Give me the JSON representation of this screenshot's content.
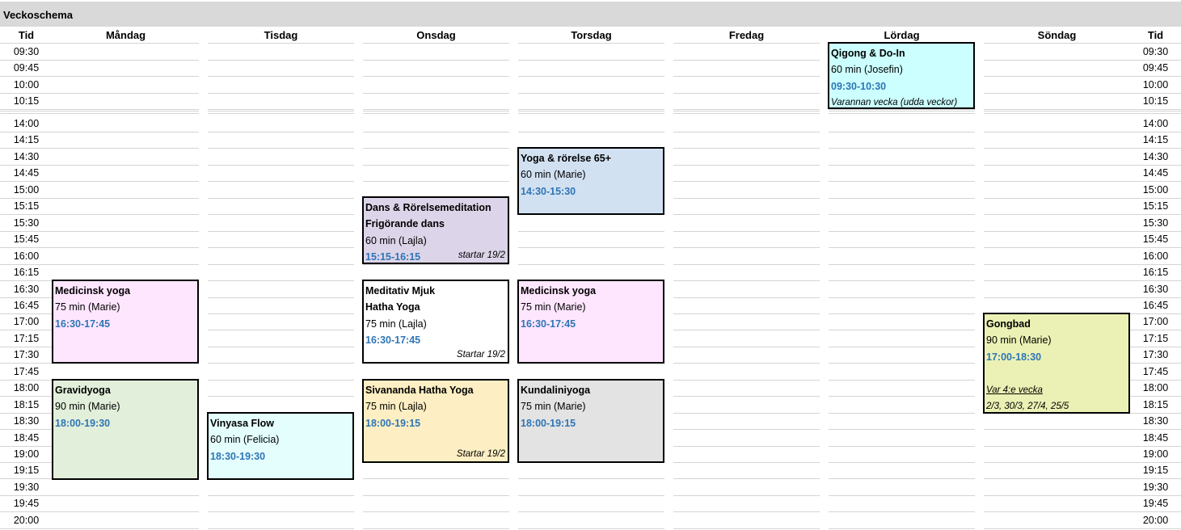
{
  "sheet": {
    "title": "Veckoschema"
  },
  "headers": {
    "tid": "Tid",
    "days": [
      "Måndag",
      "Tisdag",
      "Onsdag",
      "Torsdag",
      "Fredag",
      "Lördag",
      "Söndag"
    ]
  },
  "times": [
    "09:30",
    "09:45",
    "10:00",
    "10:15",
    "14:00",
    "14:15",
    "14:30",
    "14:45",
    "15:00",
    "15:15",
    "15:30",
    "15:45",
    "16:00",
    "16:15",
    "16:30",
    "16:45",
    "17:00",
    "17:15",
    "17:30",
    "17:45",
    "18:00",
    "18:15",
    "18:30",
    "18:45",
    "19:00",
    "19:15",
    "19:30",
    "19:45",
    "20:00"
  ],
  "classes": {
    "mon_medicinsk": {
      "title": "Medicinsk yoga",
      "info": "75 min (Marie)",
      "time": "16:30-17:45",
      "color": "#ffe6ff"
    },
    "mon_gravid": {
      "title": "Gravidyoga",
      "info": "90 min (Marie)",
      "time": "18:00-19:30",
      "color": "#e2efda"
    },
    "tue_vinyasa": {
      "title": "Vinyasa Flow",
      "info": "60 min (Felicia)",
      "time": "18:30-19:30",
      "color": "#e4fefe"
    },
    "wed_dans": {
      "title": "Dans & Rörelsemeditation",
      "title2": "Frigörande dans",
      "info": "60 min  (Lajla)",
      "time": "15:15-16:15",
      "note": "startar 19/2",
      "color": "#dcd4e8"
    },
    "wed_meditativ": {
      "title": "Meditativ Mjuk",
      "title2": "Hatha Yoga",
      "info": "75 min (Lajla)",
      "time": "16:30-17:45",
      "note": "Startar 19/2",
      "color": "#ffffff"
    },
    "wed_sivananda": {
      "title": "Sivananda Hatha Yoga",
      "info": "75 min (Lajla)",
      "time": "18:00-19:15",
      "note": "Startar 19/2",
      "color": "#fdefc3"
    },
    "thu_yoga65": {
      "title": "Yoga & rörelse 65+",
      "info": "60 min (Marie)",
      "time": "14:30-15:30",
      "color": "#d2e1f2"
    },
    "thu_medicinsk": {
      "title": "Medicinsk yoga",
      "info": "75 min (Marie)",
      "time": "16:30-17:45",
      "color": "#ffe6ff"
    },
    "thu_kundalini": {
      "title": "Kundaliniyoga",
      "info": "75 min (Marie)",
      "time": "18:00-19:15",
      "color": "#e3e3e3"
    },
    "sat_qigong": {
      "title": "Qigong & Do-In",
      "info": "60 min (Josefin)",
      "time": "09:30-10:30",
      "note": "Varannan vecka (udda veckor)",
      "color": "#ccffff"
    },
    "sun_gongbad": {
      "title": "Gongbad",
      "info": "90 min (Marie)",
      "time": "17:00-18:30",
      "note1": "Var 4:e vecka",
      "note2": "2/3, 30/3, 27/4, 25/5",
      "color": "#ebf1b4"
    }
  }
}
